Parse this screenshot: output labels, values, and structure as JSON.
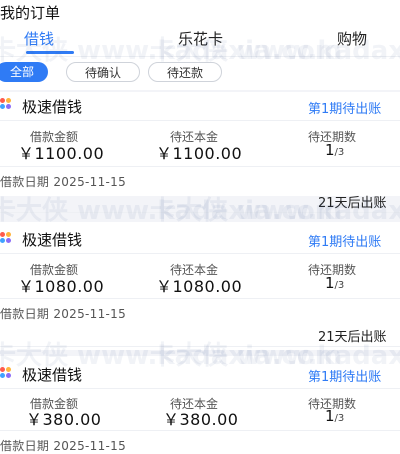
{
  "header": {
    "title": "我的订单",
    "tabs": [
      {
        "label": "借钱"
      },
      {
        "label": "乐花卡"
      },
      {
        "label": "购物"
      }
    ]
  },
  "filters": [
    {
      "label": "全部"
    },
    {
      "label": "待确认"
    },
    {
      "label": "待还款"
    }
  ],
  "columns": {
    "loan_amount": "借款金额",
    "principal_due": "待还本金",
    "periods_due": "待还期数"
  },
  "orders": [
    {
      "product": "极速借钱",
      "status": "第1期待出账",
      "loan_amount": "￥1100.00",
      "principal_due": "￥1100.00",
      "period_current": "1",
      "period_total": "/3",
      "loan_date": "借款日期 2025-11-15",
      "bill_note": "21天后出账"
    },
    {
      "product": "极速借钱",
      "status": "第1期待出账",
      "loan_amount": "￥1080.00",
      "principal_due": "￥1080.00",
      "period_current": "1",
      "period_total": "/3",
      "loan_date": "借款日期 2025-11-15",
      "bill_note": "21天后出账"
    },
    {
      "product": "极速借钱",
      "status": "第1期待出账",
      "loan_amount": "￥380.00",
      "principal_due": "￥380.00",
      "period_current": "1",
      "period_total": "/3",
      "loan_date": "借款日期 2025-11-15"
    }
  ],
  "watermark": "卡大侠 www.kadaxia.com",
  "colors": {
    "accent": "#2f7bf5",
    "background": "#f3f4f8"
  },
  "icons": {
    "product": "app-logo-icon"
  }
}
